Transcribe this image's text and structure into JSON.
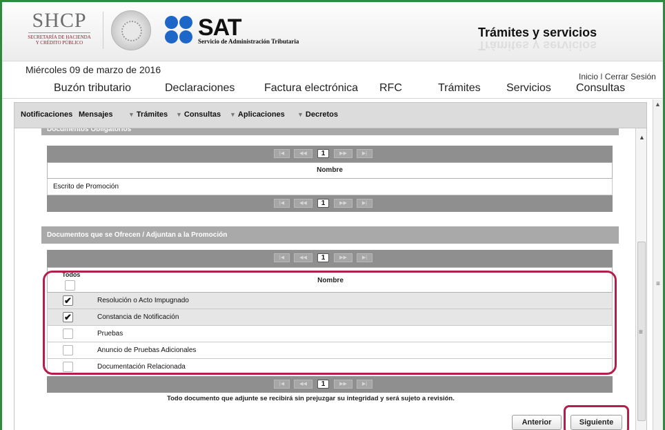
{
  "header": {
    "shcp_title": "SHCP",
    "shcp_sub1": "SECRETARÍA DE HACIENDA",
    "shcp_sub2": "Y CRÉDITO PÚBLICO",
    "sat_name": "SAT",
    "sat_full": "Servicio de Administración Tributaria",
    "section_title": "Trámites y servicios"
  },
  "date": "Miércoles 09 de marzo de 2016",
  "top_links": "Inicio | Cerrar Sesión",
  "main_nav": [
    "Buzón tributario",
    "Declaraciones",
    "Factura electrónica",
    "RFC",
    "Trámites",
    "Servicios",
    "Consultas"
  ],
  "sub_nav": [
    "Notificaciones",
    "Mensajes",
    "Trámites",
    "Consultas",
    "Aplicaciones",
    "Decretos"
  ],
  "section1": {
    "title": "Documentos Obligatorios",
    "current_page": "1",
    "column": "Nombre",
    "rows": [
      "Escrito de Promoción"
    ]
  },
  "section2": {
    "title": "Documentos que se Ofrecen / Adjuntan a la Promoción",
    "current_page": "1",
    "select_all_label": "Todos",
    "column": "Nombre",
    "rows": [
      {
        "label": "Resolución o Acto Impugnado",
        "checked": true
      },
      {
        "label": "Constancia de Notificación",
        "checked": true
      },
      {
        "label": "Pruebas",
        "checked": false
      },
      {
        "label": "Anuncio de Pruebas Adicionales",
        "checked": false
      },
      {
        "label": "Documentación Relacionada",
        "checked": false
      }
    ]
  },
  "note": "Todo documento que adjunte se recibirá sin prejuzgar su integridad y será sujeto a revisión.",
  "buttons": {
    "previous": "Anterior",
    "next": "Siguiente"
  },
  "colors": {
    "highlight": "#b31e4b",
    "frame": "#2e8b3c",
    "sat_blue": "#1f66c9"
  }
}
